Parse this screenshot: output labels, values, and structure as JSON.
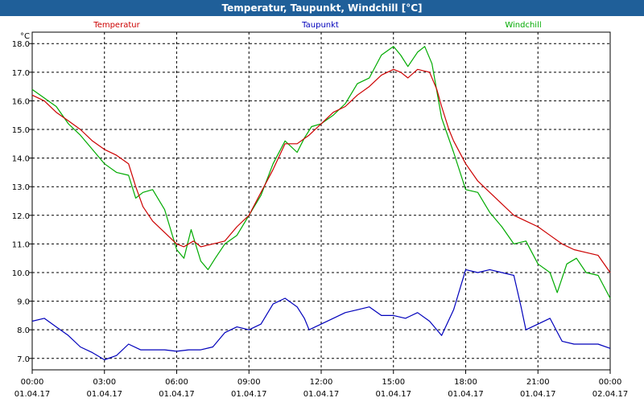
{
  "window": {
    "title": "Temperatur, Taupunkt, Windchill [°C]"
  },
  "chart_data": {
    "type": "line",
    "title": "Temperatur, Taupunkt, Windchill [°C]",
    "ylabel": "°C",
    "ylim": [
      6.6,
      18.4
    ],
    "yticks": [
      7.0,
      8.0,
      9.0,
      10.0,
      11.0,
      12.0,
      13.0,
      14.0,
      15.0,
      16.0,
      17.0,
      18.0
    ],
    "xlim": [
      0,
      24
    ],
    "xticks": [
      {
        "x": 0,
        "time": "00:00",
        "date": "01.04.17"
      },
      {
        "x": 3,
        "time": "03:00",
        "date": "01.04.17"
      },
      {
        "x": 6,
        "time": "06:00",
        "date": "01.04.17"
      },
      {
        "x": 9,
        "time": "09:00",
        "date": "01.04.17"
      },
      {
        "x": 12,
        "time": "12:00",
        "date": "01.04.17"
      },
      {
        "x": 15,
        "time": "15:00",
        "date": "01.04.17"
      },
      {
        "x": 18,
        "time": "18:00",
        "date": "01.04.17"
      },
      {
        "x": 21,
        "time": "21:00",
        "date": "01.04.17"
      },
      {
        "x": 24,
        "time": "00:00",
        "date": "02.04.17"
      }
    ],
    "grid": true,
    "legend_position": "top",
    "series": [
      {
        "name": "Temperatur",
        "color": "#cc0000",
        "points": [
          [
            0,
            16.2
          ],
          [
            0.5,
            16.0
          ],
          [
            1,
            15.6
          ],
          [
            1.5,
            15.3
          ],
          [
            2,
            15.0
          ],
          [
            2.5,
            14.6
          ],
          [
            3,
            14.3
          ],
          [
            3.5,
            14.1
          ],
          [
            4,
            13.8
          ],
          [
            4.3,
            13.0
          ],
          [
            4.6,
            12.3
          ],
          [
            5,
            11.8
          ],
          [
            5.5,
            11.4
          ],
          [
            6,
            11.0
          ],
          [
            6.3,
            10.9
          ],
          [
            6.7,
            11.1
          ],
          [
            7,
            10.9
          ],
          [
            7.5,
            11.0
          ],
          [
            8,
            11.1
          ],
          [
            8.5,
            11.6
          ],
          [
            9,
            12.0
          ],
          [
            9.5,
            12.8
          ],
          [
            10,
            13.6
          ],
          [
            10.5,
            14.5
          ],
          [
            11,
            14.5
          ],
          [
            11.5,
            14.8
          ],
          [
            12,
            15.2
          ],
          [
            12.5,
            15.6
          ],
          [
            13,
            15.8
          ],
          [
            13.5,
            16.2
          ],
          [
            14,
            16.5
          ],
          [
            14.5,
            16.9
          ],
          [
            15,
            17.1
          ],
          [
            15.3,
            17.0
          ],
          [
            15.6,
            16.8
          ],
          [
            16,
            17.1
          ],
          [
            16.5,
            17.0
          ],
          [
            16.8,
            16.4
          ],
          [
            17,
            15.8
          ],
          [
            17.3,
            15.0
          ],
          [
            17.5,
            14.6
          ],
          [
            18,
            13.8
          ],
          [
            18.5,
            13.2
          ],
          [
            19,
            12.8
          ],
          [
            19.5,
            12.4
          ],
          [
            20,
            12.0
          ],
          [
            20.5,
            11.8
          ],
          [
            21,
            11.6
          ],
          [
            21.5,
            11.3
          ],
          [
            22,
            11.0
          ],
          [
            22.5,
            10.8
          ],
          [
            23,
            10.7
          ],
          [
            23.5,
            10.6
          ],
          [
            24,
            10.0
          ]
        ]
      },
      {
        "name": "Taupunkt",
        "color": "#0000bb",
        "points": [
          [
            0,
            8.3
          ],
          [
            0.5,
            8.4
          ],
          [
            1,
            8.1
          ],
          [
            1.5,
            7.8
          ],
          [
            2,
            7.4
          ],
          [
            2.5,
            7.2
          ],
          [
            3,
            6.95
          ],
          [
            3.5,
            7.1
          ],
          [
            4,
            7.5
          ],
          [
            4.5,
            7.3
          ],
          [
            5,
            7.3
          ],
          [
            5.5,
            7.3
          ],
          [
            6,
            7.25
          ],
          [
            6.5,
            7.3
          ],
          [
            7,
            7.3
          ],
          [
            7.5,
            7.4
          ],
          [
            8,
            7.9
          ],
          [
            8.5,
            8.1
          ],
          [
            9,
            8.0
          ],
          [
            9.5,
            8.2
          ],
          [
            10,
            8.9
          ],
          [
            10.5,
            9.1
          ],
          [
            11,
            8.8
          ],
          [
            11.3,
            8.4
          ],
          [
            11.5,
            8.0
          ],
          [
            12,
            8.2
          ],
          [
            12.5,
            8.4
          ],
          [
            13,
            8.6
          ],
          [
            13.5,
            8.7
          ],
          [
            14,
            8.8
          ],
          [
            14.5,
            8.5
          ],
          [
            15,
            8.5
          ],
          [
            15.5,
            8.4
          ],
          [
            16,
            8.6
          ],
          [
            16.5,
            8.3
          ],
          [
            17,
            7.8
          ],
          [
            17.5,
            8.7
          ],
          [
            18,
            10.1
          ],
          [
            18.5,
            10.0
          ],
          [
            19,
            10.1
          ],
          [
            19.5,
            10.0
          ],
          [
            20,
            9.9
          ],
          [
            20.3,
            8.8
          ],
          [
            20.5,
            8.0
          ],
          [
            21,
            8.2
          ],
          [
            21.5,
            8.4
          ],
          [
            22,
            7.6
          ],
          [
            22.5,
            7.5
          ],
          [
            23,
            7.5
          ],
          [
            23.5,
            7.5
          ],
          [
            24,
            7.35
          ]
        ]
      },
      {
        "name": "Windchill",
        "color": "#00aa00",
        "points": [
          [
            0,
            16.4
          ],
          [
            0.5,
            16.1
          ],
          [
            1,
            15.8
          ],
          [
            1.5,
            15.2
          ],
          [
            2,
            14.8
          ],
          [
            2.5,
            14.3
          ],
          [
            3,
            13.8
          ],
          [
            3.5,
            13.5
          ],
          [
            4,
            13.4
          ],
          [
            4.3,
            12.6
          ],
          [
            4.6,
            12.8
          ],
          [
            5,
            12.9
          ],
          [
            5.5,
            12.2
          ],
          [
            6,
            10.8
          ],
          [
            6.3,
            10.5
          ],
          [
            6.6,
            11.5
          ],
          [
            7,
            10.4
          ],
          [
            7.3,
            10.1
          ],
          [
            7.6,
            10.5
          ],
          [
            8,
            11.0
          ],
          [
            8.5,
            11.3
          ],
          [
            9,
            12.0
          ],
          [
            9.5,
            12.7
          ],
          [
            10,
            13.8
          ],
          [
            10.5,
            14.6
          ],
          [
            11,
            14.2
          ],
          [
            11.3,
            14.7
          ],
          [
            11.6,
            15.1
          ],
          [
            12,
            15.2
          ],
          [
            12.5,
            15.5
          ],
          [
            13,
            15.9
          ],
          [
            13.5,
            16.6
          ],
          [
            14,
            16.8
          ],
          [
            14.5,
            17.6
          ],
          [
            15,
            17.9
          ],
          [
            15.3,
            17.6
          ],
          [
            15.6,
            17.2
          ],
          [
            16,
            17.7
          ],
          [
            16.3,
            17.9
          ],
          [
            16.6,
            17.3
          ],
          [
            17,
            15.4
          ],
          [
            17.5,
            14.2
          ],
          [
            18,
            12.9
          ],
          [
            18.5,
            12.8
          ],
          [
            19,
            12.1
          ],
          [
            19.5,
            11.6
          ],
          [
            20,
            11.0
          ],
          [
            20.5,
            11.1
          ],
          [
            21,
            10.3
          ],
          [
            21.5,
            10.0
          ],
          [
            21.8,
            9.3
          ],
          [
            22.2,
            10.3
          ],
          [
            22.6,
            10.5
          ],
          [
            23,
            10.0
          ],
          [
            23.5,
            9.9
          ],
          [
            24,
            9.1
          ]
        ]
      }
    ]
  }
}
